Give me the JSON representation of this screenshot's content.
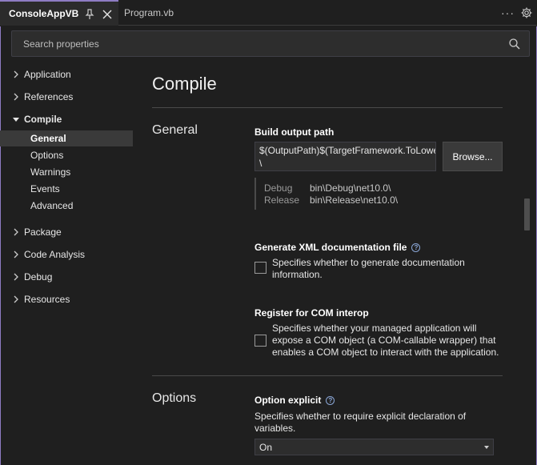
{
  "tabs": [
    {
      "label": "ConsoleAppVB",
      "active": true
    },
    {
      "label": "Program.vb",
      "active": false
    }
  ],
  "search": {
    "placeholder": "Search properties"
  },
  "nav": {
    "items": [
      {
        "label": "Application",
        "expanded": false
      },
      {
        "label": "References",
        "expanded": false
      },
      {
        "label": "Compile",
        "expanded": true
      },
      {
        "label": "Package",
        "expanded": false
      },
      {
        "label": "Code Analysis",
        "expanded": false
      },
      {
        "label": "Debug",
        "expanded": false
      },
      {
        "label": "Resources",
        "expanded": false
      }
    ],
    "compile_children": [
      {
        "label": "General",
        "selected": true
      },
      {
        "label": "Options",
        "selected": false
      },
      {
        "label": "Warnings",
        "selected": false
      },
      {
        "label": "Events",
        "selected": false
      },
      {
        "label": "Advanced",
        "selected": false
      }
    ]
  },
  "content": {
    "title": "Compile",
    "general_section": "General",
    "build_output": {
      "label": "Build output path",
      "value_line1": "$(OutputPath)$(TargetFramework.ToLowe",
      "value_line2": "\\",
      "browse_label": "Browse...",
      "configs": [
        {
          "name": "Debug",
          "value": "bin\\Debug\\net10.0\\"
        },
        {
          "name": "Release",
          "value": "bin\\Release\\net10.0\\"
        }
      ]
    },
    "xml_doc": {
      "label": "Generate XML documentation file",
      "description": "Specifies whether to generate documentation information.",
      "checked": false
    },
    "com_interop": {
      "label": "Register for COM interop",
      "description": "Specifies whether your managed application will expose a COM object (a COM-callable wrapper) that enables a COM object to interact with the application.",
      "checked": false
    },
    "options_section": "Options",
    "option_explicit": {
      "label": "Option explicit",
      "description": "Specifies whether to require explicit declaration of variables.",
      "value": "On"
    }
  },
  "colors": {
    "accent": "#8e7cc3",
    "background": "#1f1f1f",
    "selected_nav": "#3a3a3a"
  }
}
